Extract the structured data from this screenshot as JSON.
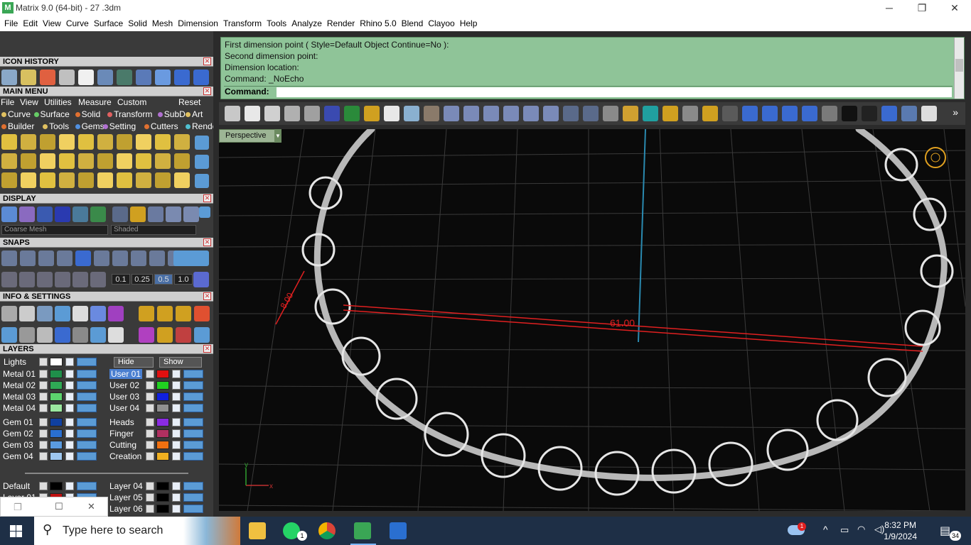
{
  "window": {
    "title": "Matrix 9.0 (64-bit) - 27 .3dm",
    "minimize": "─",
    "restore": "❐",
    "close": "✕"
  },
  "menu": [
    "File",
    "Edit",
    "View",
    "Curve",
    "Surface",
    "Solid",
    "Mesh",
    "Dimension",
    "Transform",
    "Tools",
    "Analyze",
    "Render",
    "Rhino 5.0",
    "Blend",
    "Clayoo",
    "Help"
  ],
  "panels": {
    "icon_history": "ICON HISTORY",
    "main_menu": "MAIN MENU",
    "display": "DISPLAY",
    "snaps": "SNAPS",
    "info_settings": "INFO & SETTINGS",
    "layers": "LAYERS"
  },
  "main_menu": {
    "nav": [
      "File",
      "View",
      "Utilities",
      "Measure",
      "Custom"
    ],
    "reset": "Reset",
    "row1": [
      {
        "label": "Curve",
        "color": "#e0c060"
      },
      {
        "label": "Surface",
        "color": "#66cc66"
      },
      {
        "label": "Solid",
        "color": "#e07030"
      },
      {
        "label": "Transform",
        "color": "#e06060"
      },
      {
        "label": "SubD",
        "color": "#b070d0"
      },
      {
        "label": "Art",
        "color": "#e0c060"
      }
    ],
    "row2": [
      {
        "label": "Builder",
        "color": "#e07030"
      },
      {
        "label": "Tools",
        "color": "#e0c060"
      },
      {
        "label": "Gems",
        "color": "#5090e0"
      },
      {
        "label": "Setting",
        "color": "#b070d0"
      },
      {
        "label": "Cutters",
        "color": "#e07030"
      },
      {
        "label": "Render",
        "color": "#50c0d0"
      }
    ]
  },
  "display": {
    "mesh_select": "Coarse Mesh",
    "shade_select": "Shaded"
  },
  "snaps": {
    "steps": [
      "0.1",
      "0.25",
      "0.5",
      "1.0"
    ],
    "active_step": "0.5"
  },
  "layers": {
    "lights": "Lights",
    "hide": "Hide",
    "show": "Show",
    "left": [
      {
        "name": "Metal 01",
        "color": "#1f8f4a"
      },
      {
        "name": "Metal 02",
        "color": "#2faa55"
      },
      {
        "name": "Metal 03",
        "color": "#5cd46e"
      },
      {
        "name": "Metal 04",
        "color": "#9be89f"
      },
      {
        "name": "Gem 01",
        "color": "#1040a0"
      },
      {
        "name": "Gem 02",
        "color": "#2a6fd0"
      },
      {
        "name": "Gem 03",
        "color": "#5a9be0"
      },
      {
        "name": "Gem 04",
        "color": "#9ec7f0"
      }
    ],
    "right": [
      {
        "name": "User 01",
        "color": "#e01010",
        "active": true
      },
      {
        "name": "User 02",
        "color": "#20d020"
      },
      {
        "name": "User 03",
        "color": "#1020e0"
      },
      {
        "name": "User 04",
        "color": "#909090"
      },
      {
        "name": "Heads",
        "color": "#8a2be2"
      },
      {
        "name": "Finger",
        "color": "#b03060"
      },
      {
        "name": "Cutting",
        "color": "#f07010"
      },
      {
        "name": "Creation",
        "color": "#f0b020"
      }
    ],
    "bottom_left": [
      {
        "name": "Default",
        "color": "#000000"
      },
      {
        "name": "Layer 01",
        "color": "#c01010"
      },
      {
        "name": "Layer 02",
        "color": "#888888"
      }
    ],
    "bottom_right": [
      {
        "name": "Layer 04",
        "color": "#000000"
      },
      {
        "name": "Layer 05",
        "color": "#000000"
      },
      {
        "name": "Layer 06",
        "color": "#000000"
      }
    ]
  },
  "command": {
    "history": [
      "First dimension point ( Style=Default  Object  Continue=No ):",
      "Second dimension point:",
      "Dimension location:",
      "Command: _NoEcho"
    ],
    "prompt": "Command:",
    "value": ""
  },
  "viewport": {
    "name": "Perspective",
    "dim_long": "61.00",
    "dim_short": "8.00",
    "axis_x": "x",
    "axis_y": "y"
  },
  "taskbar": {
    "search_placeholder": "Type here to search",
    "time": "8:32 PM",
    "date": "1/9/2024",
    "notifications": "34",
    "whatsapp_badge": "1",
    "weather_badge": "1"
  }
}
